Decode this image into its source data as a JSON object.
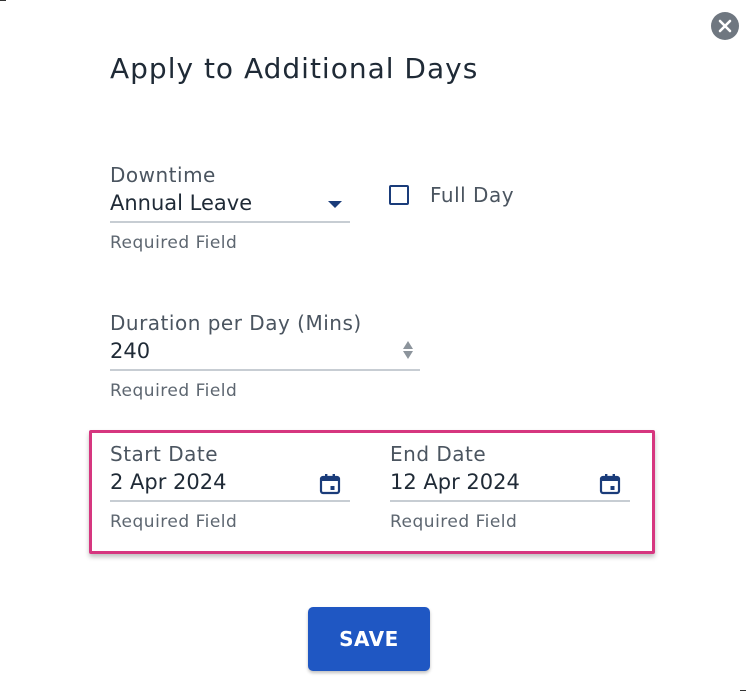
{
  "dialog": {
    "title": "Apply to Additional Days",
    "close_icon": "close-circle-icon"
  },
  "downtime": {
    "label": "Downtime",
    "value": "Annual Leave",
    "helper": "Required Field"
  },
  "full_day": {
    "label": "Full Day",
    "checked": false
  },
  "duration": {
    "label": "Duration per Day (Mins)",
    "value": "240",
    "helper": "Required Field"
  },
  "start_date": {
    "label": "Start Date",
    "value": "2 Apr 2024",
    "helper": "Required Field",
    "icon": "calendar-icon"
  },
  "end_date": {
    "label": "End Date",
    "value": "12 Apr 2024",
    "helper": "Required Field",
    "icon": "calendar-icon"
  },
  "actions": {
    "save_label": "SAVE"
  },
  "colors": {
    "accent": "#1f57c3",
    "highlight": "#d6367f",
    "icon": "#1a3c7a"
  }
}
